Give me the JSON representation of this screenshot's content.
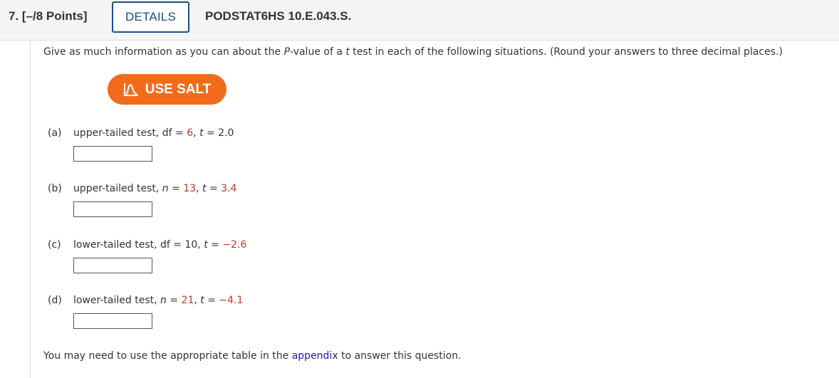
{
  "header": {
    "question_number": "7. [–/8 Points]",
    "details_label": "DETAILS",
    "problem_code": "PODSTAT6HS 10.E.043.S."
  },
  "intro": {
    "before_p": "Give as much information as you can about the ",
    "p_var": "P",
    "middle": "-value of a ",
    "t_var": "t",
    "after": " test in each of the following situations. (Round your answers to three decimal places.)"
  },
  "salt_button": {
    "label": "USE SALT",
    "icon": "salt-chart-icon",
    "color": "#f26b1d"
  },
  "parts": [
    {
      "label": "(a)",
      "test": "upper-tailed test, ",
      "param_name": "df",
      "param_value": "6",
      "t_value": "2.0",
      "answer": ""
    },
    {
      "label": "(b)",
      "test": "upper-tailed test, ",
      "param_name": "n",
      "param_value": "13",
      "t_value": "3.4",
      "answer": ""
    },
    {
      "label": "(c)",
      "test": "lower-tailed test, ",
      "param_name": "df",
      "param_value": "10",
      "t_value": "−2.6",
      "answer": ""
    },
    {
      "label": "(d)",
      "test": "lower-tailed test, ",
      "param_name": "n",
      "param_value": "21",
      "t_value": "−4.1",
      "answer": ""
    }
  ],
  "symbols": {
    "equals": " = ",
    "comma": ", ",
    "t": "t"
  },
  "footer": {
    "before": "You may need to use the appropriate table in the ",
    "link": "appendix",
    "after": " to answer this question."
  },
  "colors": {
    "accent": "#1b4f86",
    "highlight": "#c0392b",
    "salt": "#f26b1d",
    "link": "#1b1b9a"
  }
}
